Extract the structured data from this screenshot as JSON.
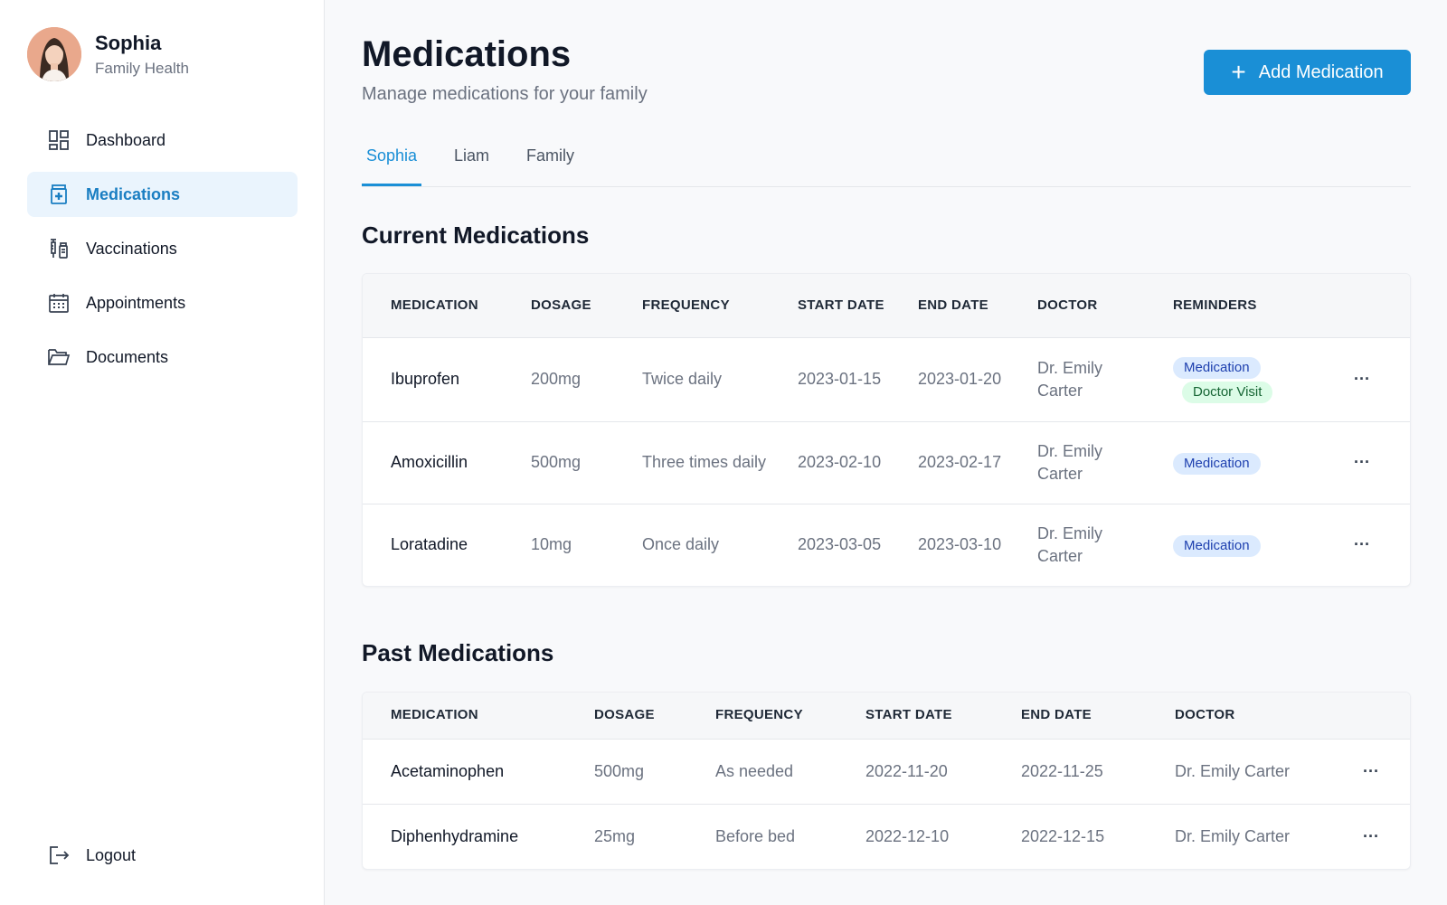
{
  "profile": {
    "name": "Sophia",
    "subtitle": "Family Health"
  },
  "nav": [
    {
      "label": "Dashboard",
      "icon": "dashboard-icon"
    },
    {
      "label": "Medications",
      "icon": "medication-icon",
      "active": true
    },
    {
      "label": "Vaccinations",
      "icon": "vaccination-icon"
    },
    {
      "label": "Appointments",
      "icon": "calendar-icon"
    },
    {
      "label": "Documents",
      "icon": "folder-icon"
    }
  ],
  "logout_label": "Logout",
  "header": {
    "title": "Medications",
    "subtitle": "Manage medications for your family",
    "add_button": "Add Medication"
  },
  "tabs": [
    "Sophia",
    "Liam",
    "Family"
  ],
  "active_tab": "Sophia",
  "current": {
    "title": "Current Medications",
    "headers": [
      "MEDICATION",
      "DOSAGE",
      "FREQUENCY",
      "START DATE",
      "END DATE",
      "DOCTOR",
      "REMINDERS"
    ],
    "rows": [
      {
        "medication": "Ibuprofen",
        "dosage": "200mg",
        "frequency": "Twice daily",
        "start": "2023-01-15",
        "end": "2023-01-20",
        "doctor": "Dr. Emily Carter",
        "reminders": [
          "Medication",
          "Doctor Visit"
        ]
      },
      {
        "medication": "Amoxicillin",
        "dosage": "500mg",
        "frequency": "Three times daily",
        "start": "2023-02-10",
        "end": "2023-02-17",
        "doctor": "Dr. Emily Carter",
        "reminders": [
          "Medication"
        ]
      },
      {
        "medication": "Loratadine",
        "dosage": "10mg",
        "frequency": "Once daily",
        "start": "2023-03-05",
        "end": "2023-03-10",
        "doctor": "Dr. Emily Carter",
        "reminders": [
          "Medication"
        ]
      }
    ]
  },
  "past": {
    "title": "Past Medications",
    "headers": [
      "MEDICATION",
      "DOSAGE",
      "FREQUENCY",
      "START DATE",
      "END DATE",
      "DOCTOR"
    ],
    "rows": [
      {
        "medication": "Acetaminophen",
        "dosage": "500mg",
        "frequency": "As needed",
        "start": "2022-11-20",
        "end": "2022-11-25",
        "doctor": "Dr. Emily Carter"
      },
      {
        "medication": "Diphenhydramine",
        "dosage": "25mg",
        "frequency": "Before bed",
        "start": "2022-12-10",
        "end": "2022-12-15",
        "doctor": "Dr. Emily Carter"
      }
    ]
  },
  "more_icon": "more-horizontal-icon",
  "colors": {
    "accent": "#1a8fd6",
    "active_nav_bg": "#eaf4fd",
    "badge_medication": "#dbeafe",
    "badge_doctor_visit": "#dcfce7"
  }
}
